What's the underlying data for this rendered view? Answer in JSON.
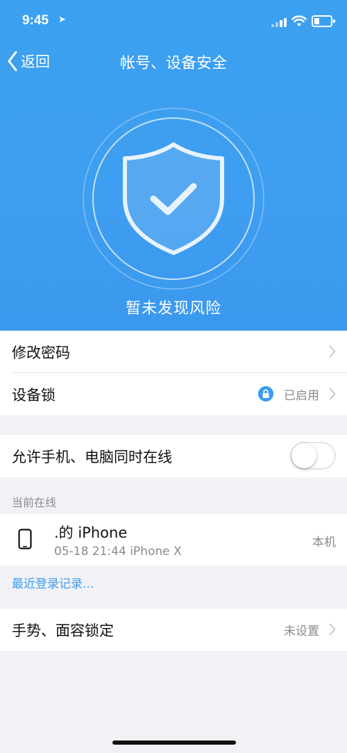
{
  "status_bar": {
    "time": "9:45"
  },
  "nav": {
    "back_label": "返回",
    "title": "帐号、设备安全"
  },
  "hero": {
    "status_text": "暂未发现风险"
  },
  "security_rows": {
    "change_password": "修改密码",
    "device_lock": "设备锁",
    "device_lock_status": "已启用"
  },
  "online": {
    "allow_both_label": "允许手机、电脑同时在线",
    "allow_both_enabled": false
  },
  "current_online": {
    "caption": "当前在线",
    "device_name": ".的 iPhone",
    "device_meta": "05-18 21:44  iPhone X",
    "device_tag": "本机"
  },
  "recent_login_link": "最近登录记录...",
  "gesture": {
    "label": "手势、面容锁定",
    "value": "未设置"
  },
  "colors": {
    "accent": "#3a9cf0",
    "hero_bg": "#3f9ef0",
    "page_bg": "#f2f2f6"
  }
}
